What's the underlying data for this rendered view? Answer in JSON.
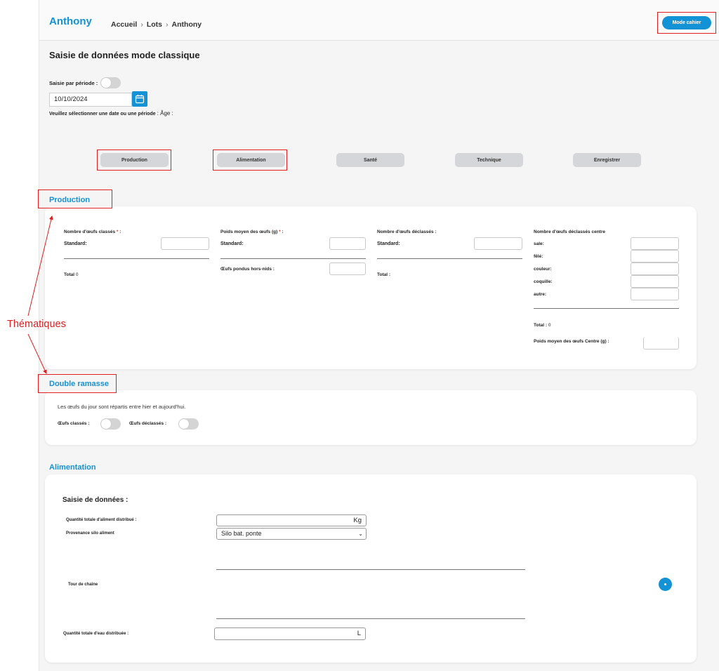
{
  "header": {
    "title": "Anthony",
    "breadcrumb": [
      "Accueil",
      "Lots",
      "Anthony"
    ],
    "breadcrumb_sep": "›",
    "mode_button": "Mode cahier"
  },
  "page": {
    "title": "Saisie de données mode classique",
    "period_label": "Saisie par période :",
    "date_value": "10/10/2024",
    "hint_bold": "Veuillez sélectionner une date ou une période",
    "hint_age": ": Âge :"
  },
  "tabs": [
    "Production",
    "Alimentation",
    "Santé",
    "Technique",
    "Enregistrer"
  ],
  "annotation": "Thématiques",
  "production": {
    "title": "Production",
    "col1_label": "Nombre d'œufs classés",
    "col1_sub": "Standard:",
    "col1_total_label": "Total",
    "col1_total_value": "0",
    "col2_label": "Poids moyen des œufs (g)",
    "col2_sub": "Standard:",
    "col2_hors_nids": "Œufs pondus hors-nids :",
    "col3_label": "Nombre d'œufs déclassés :",
    "col3_sub": "Standard:",
    "col3_total": "Total :",
    "col4_label": "Nombre d'œufs déclassés centre",
    "col4_rows": [
      "sale:",
      "fêlé:",
      "couleur:",
      "coquille:",
      "autre:"
    ],
    "col4_total_label": "Total :",
    "col4_total_value": "0",
    "col4_poids": "Poids moyen des œufs Centre (g) :",
    "required_mark": "*",
    "colon": ":"
  },
  "double_ramasse": {
    "title": "Double ramasse",
    "text": "Les œufs du jour sont répartis entre hier et aujourd'hui.",
    "oeufs_classes": "Œufs classés :",
    "oeufs_declasses": "Œufs déclassés :"
  },
  "alimentation": {
    "title": "Alimentation",
    "subtitle": "Saisie de données :",
    "qte_aliment_label": "Quantité totale d'aliment distribué :",
    "qte_aliment_unit": "Kg",
    "provenance_label": "Provenance silo aliment",
    "provenance_value": "Silo bat. ponte",
    "tour_chaine_label": "Tour de chaîne",
    "qte_eau_label": "Quantité totale d'eau distribuée :",
    "qte_eau_unit": "L"
  },
  "colors": {
    "accent": "#1492d6",
    "annotation": "#e02020"
  }
}
